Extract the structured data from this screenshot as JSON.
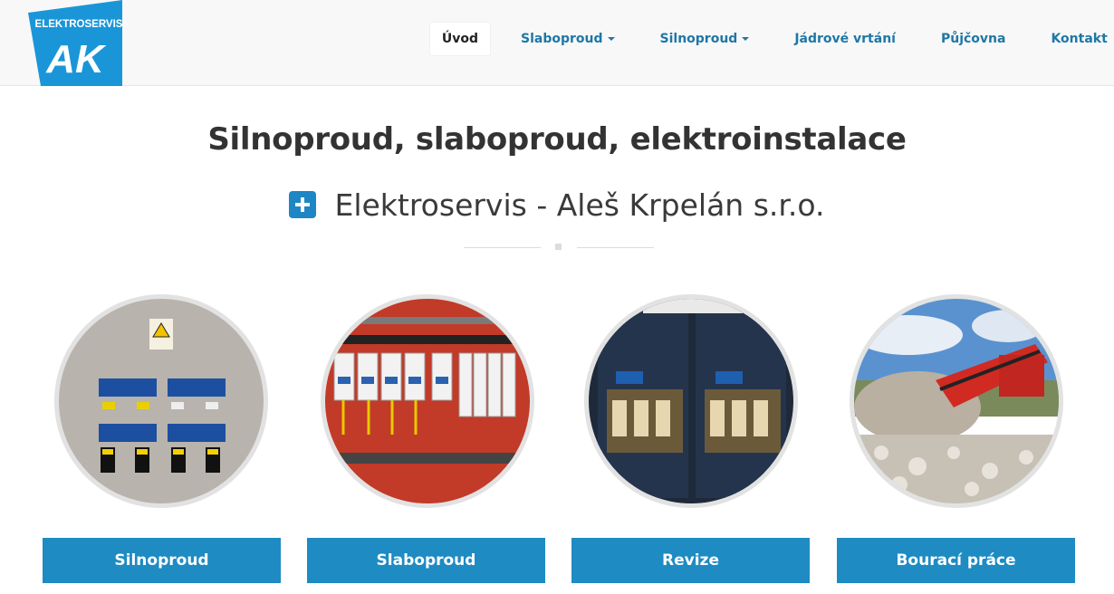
{
  "brand": {
    "logo_text": "ELEKTROSERVIS",
    "logo_mark": "AK",
    "color": "#1a96d8"
  },
  "nav": {
    "items": [
      {
        "label": "Úvod",
        "active": true
      },
      {
        "label": "Slaboproud",
        "dropdown": true
      },
      {
        "label": "Silnoproud",
        "dropdown": true
      },
      {
        "label": "Jádrové vrtání"
      },
      {
        "label": "Půjčovna"
      },
      {
        "label": "Kontakt"
      }
    ]
  },
  "hero": {
    "title": "Silnoproud, slaboproud, elektroinstalace",
    "subtitle": "Elektroservis - Aleš Krpelán s.r.o."
  },
  "cards": [
    {
      "label": "Silnoproud",
      "image": "electrical-panel-photo"
    },
    {
      "label": "Slaboproud",
      "image": "circuit-breakers-photo"
    },
    {
      "label": "Revize",
      "image": "fuse-switches-photo"
    },
    {
      "label": "Bourací práce",
      "image": "demolition-crusher-photo"
    }
  ],
  "colors": {
    "accent": "#1e8bc3",
    "nav_link": "#1e77a6"
  }
}
